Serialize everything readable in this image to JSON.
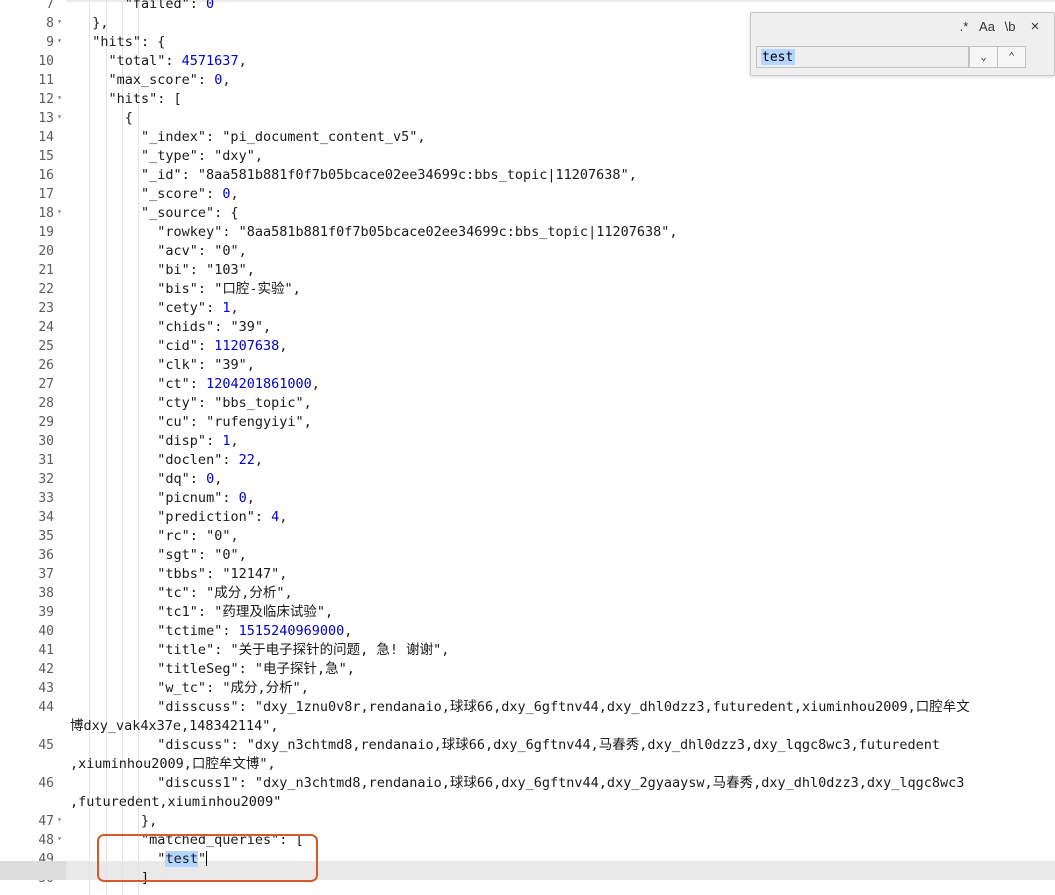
{
  "search": {
    "regex_label": ".*",
    "case_label": "Aa",
    "word_label": "\\b",
    "close_icon": "close-icon",
    "query": "test",
    "next_icon": "chevron-down-icon",
    "prev_icon": "chevron-up-icon"
  },
  "current_line": 49,
  "lines": [
    {
      "n": "7",
      "fold": false,
      "indent": 3,
      "text": "\"failed\": 0"
    },
    {
      "n": "8",
      "fold": true,
      "indent": 1,
      "text": "},"
    },
    {
      "n": "9",
      "fold": true,
      "indent": 1,
      "text": "\"hits\": {"
    },
    {
      "n": "10",
      "fold": false,
      "indent": 2,
      "text": "\"total\": 4571637,"
    },
    {
      "n": "11",
      "fold": false,
      "indent": 2,
      "text": "\"max_score\": 0,"
    },
    {
      "n": "12",
      "fold": true,
      "indent": 2,
      "text": "\"hits\": ["
    },
    {
      "n": "13",
      "fold": true,
      "indent": 3,
      "text": "{"
    },
    {
      "n": "14",
      "fold": false,
      "indent": 4,
      "text": "\"_index\": \"pi_document_content_v5\","
    },
    {
      "n": "15",
      "fold": false,
      "indent": 4,
      "text": "\"_type\": \"dxy\","
    },
    {
      "n": "16",
      "fold": false,
      "indent": 4,
      "text": "\"_id\": \"8aa581b881f0f7b05bcace02ee34699c:bbs_topic|11207638\","
    },
    {
      "n": "17",
      "fold": false,
      "indent": 4,
      "text": "\"_score\": 0,"
    },
    {
      "n": "18",
      "fold": true,
      "indent": 4,
      "text": "\"_source\": {"
    },
    {
      "n": "19",
      "fold": false,
      "indent": 5,
      "text": "\"rowkey\": \"8aa581b881f0f7b05bcace02ee34699c:bbs_topic|11207638\","
    },
    {
      "n": "20",
      "fold": false,
      "indent": 5,
      "text": "\"acv\": \"0\","
    },
    {
      "n": "21",
      "fold": false,
      "indent": 5,
      "text": "\"bi\": \"103\","
    },
    {
      "n": "22",
      "fold": false,
      "indent": 5,
      "text": "\"bis\": \"口腔-实验\","
    },
    {
      "n": "23",
      "fold": false,
      "indent": 5,
      "text": "\"cety\": 1,"
    },
    {
      "n": "24",
      "fold": false,
      "indent": 5,
      "text": "\"chids\": \"39\","
    },
    {
      "n": "25",
      "fold": false,
      "indent": 5,
      "text": "\"cid\": 11207638,"
    },
    {
      "n": "26",
      "fold": false,
      "indent": 5,
      "text": "\"clk\": \"39\","
    },
    {
      "n": "27",
      "fold": false,
      "indent": 5,
      "text": "\"ct\": 1204201861000,"
    },
    {
      "n": "28",
      "fold": false,
      "indent": 5,
      "text": "\"cty\": \"bbs_topic\","
    },
    {
      "n": "29",
      "fold": false,
      "indent": 5,
      "text": "\"cu\": \"rufengyiyi\","
    },
    {
      "n": "30",
      "fold": false,
      "indent": 5,
      "text": "\"disp\": 1,"
    },
    {
      "n": "31",
      "fold": false,
      "indent": 5,
      "text": "\"doclen\": 22,"
    },
    {
      "n": "32",
      "fold": false,
      "indent": 5,
      "text": "\"dq\": 0,"
    },
    {
      "n": "33",
      "fold": false,
      "indent": 5,
      "text": "\"picnum\": 0,"
    },
    {
      "n": "34",
      "fold": false,
      "indent": 5,
      "text": "\"prediction\": 4,"
    },
    {
      "n": "35",
      "fold": false,
      "indent": 5,
      "text": "\"rc\": \"0\","
    },
    {
      "n": "36",
      "fold": false,
      "indent": 5,
      "text": "\"sgt\": \"0\","
    },
    {
      "n": "37",
      "fold": false,
      "indent": 5,
      "text": "\"tbbs\": \"12147\","
    },
    {
      "n": "38",
      "fold": false,
      "indent": 5,
      "text": "\"tc\": \"成分,分析\","
    },
    {
      "n": "39",
      "fold": false,
      "indent": 5,
      "text": "\"tc1\": \"药理及临床试验\","
    },
    {
      "n": "40",
      "fold": false,
      "indent": 5,
      "text": "\"tctime\": 1515240969000,"
    },
    {
      "n": "41",
      "fold": false,
      "indent": 5,
      "text": "\"title\": \"关于电子探针的问题, 急! 谢谢\","
    },
    {
      "n": "42",
      "fold": false,
      "indent": 5,
      "text": "\"titleSeg\": \"电子探针,急\","
    },
    {
      "n": "43",
      "fold": false,
      "indent": 5,
      "text": "\"w_tc\": \"成分,分析\","
    },
    {
      "n": "44",
      "fold": false,
      "indent": 5,
      "text": "\"disscuss\": \"dxy_1znu0v8r,rendanaio,球球66,dxy_6gftnv44,dxy_dhl0dzz3,futuredent,xiuminhou2009,口腔牟文",
      "wrap": "博dxy_vak4x37e,148342114\","
    },
    {
      "n": "45",
      "fold": false,
      "indent": 5,
      "text": "\"discuss\": \"dxy_n3chtmd8,rendanaio,球球66,dxy_6gftnv44,马春秀,dxy_dhl0dzz3,dxy_lqgc8wc3,futuredent",
      "wrap": ",xiuminhou2009,口腔牟文博\","
    },
    {
      "n": "46",
      "fold": false,
      "indent": 5,
      "text": "\"discuss1\": \"dxy_n3chtmd8,rendanaio,球球66,dxy_6gftnv44,dxy_2gyaaysw,马春秀,dxy_dhl0dzz3,dxy_lqgc8wc3",
      "wrap": ",futuredent,xiuminhou2009\""
    },
    {
      "n": "47",
      "fold": true,
      "indent": 4,
      "text": "},"
    },
    {
      "n": "48",
      "fold": true,
      "indent": 4,
      "text": "\"matched_queries\": ["
    },
    {
      "n": "49",
      "fold": false,
      "indent": 5,
      "text": "\"test\""
    },
    {
      "n": "50",
      "fold": false,
      "indent": 4,
      "text": "]"
    }
  ]
}
